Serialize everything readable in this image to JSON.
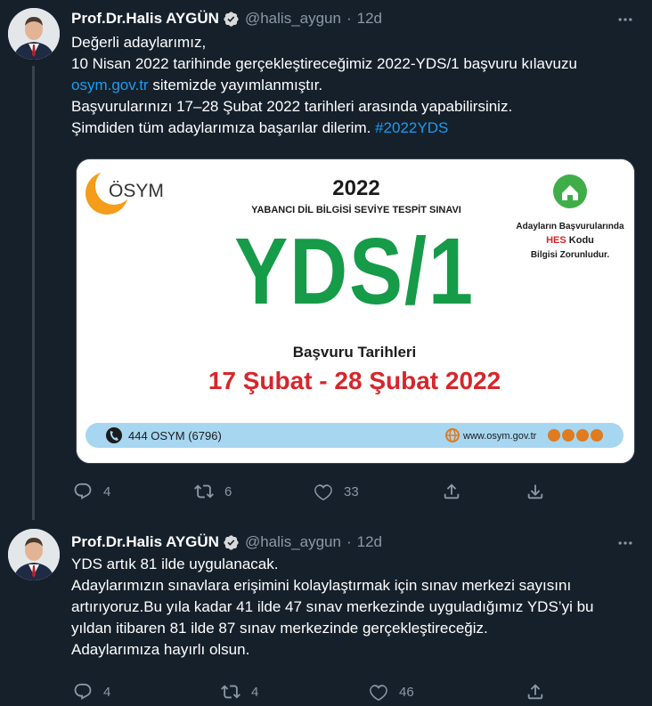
{
  "tweets": [
    {
      "author_name": "Prof.Dr.Halis AYGÜN",
      "handle": "@halis_aygun",
      "separator": "·",
      "time": "12d",
      "lines": [
        {
          "text": "Değerli adaylarımız,"
        },
        {
          "text": "10 Nisan 2022 tarihinde gerçekleştireceğimiz 2022-YDS/1 başvuru kılavuzu"
        },
        {
          "link": "osym.gov.tr",
          "text": " sitemizde yayımlanmıştır."
        },
        {
          "text": "Başvurularınızı 17–28 Şubat 2022 tarihleri arasında yapabilirsiniz."
        },
        {
          "text": "Şimdiden tüm adaylarımıza başarılar dilerim. ",
          "hashtag": "#2022YDS"
        }
      ],
      "image": {
        "logo": "ÖSYM",
        "year": "2022",
        "subtitle": "YABANCI DİL BİLGİSİ SEVİYE TESPİT SINAVI",
        "big_title": "YDS/1",
        "hes_line1": "Adayların Başvurularında",
        "hes_line2_a": "HES",
        "hes_line2_b": " Kodu",
        "hes_line3": "Bilgisi Zorunludur.",
        "dates_label": "Başvuru Tarihleri",
        "dates": "17 Şubat - 28 Şubat 2022",
        "phone": "444 OSYM (6796)",
        "website": "www.osym.gov.tr"
      },
      "stats": {
        "replies": "4",
        "retweets": "6",
        "likes": "33"
      }
    },
    {
      "author_name": "Prof.Dr.Halis AYGÜN",
      "handle": "@halis_aygun",
      "separator": "·",
      "time": "12d",
      "lines": [
        {
          "text": "YDS artık 81 ilde uygulanacak."
        },
        {
          "text": "Adaylarımızın sınavlara erişimini kolaylaştırmak için sınav merkezi sayısını"
        },
        {
          "text": "artırıyoruz.Bu yıla kadar 41 ilde 47 sınav merkezinde uyguladığımız YDS’yi bu"
        },
        {
          "text": "yıldan itibaren 81 ilde 87 sınav merkezinde gerçekleştireceğiz."
        },
        {
          "text": "Adaylarımıza hayırlı olsun."
        }
      ],
      "stats": {
        "replies": "4",
        "retweets": "4",
        "likes": "46"
      }
    }
  ],
  "colors": {
    "background": "#15202b",
    "link": "#1d9bf0",
    "muted": "#8b98a5",
    "verified": "#1d9bf0",
    "yds_green": "#169b48",
    "date_red": "#d7262b",
    "osym_orange": "#f59c1a"
  }
}
